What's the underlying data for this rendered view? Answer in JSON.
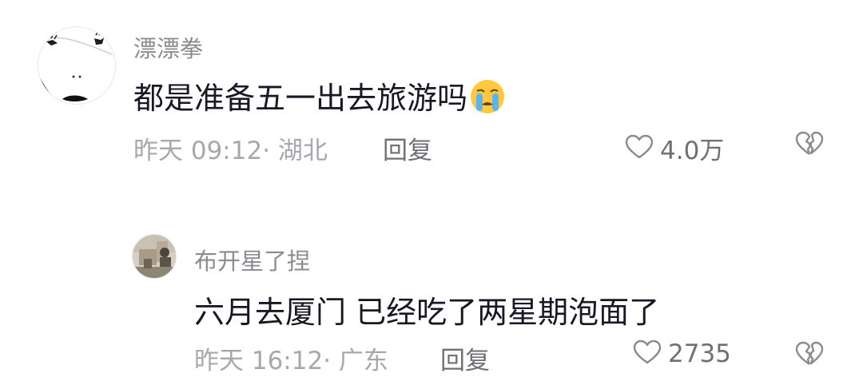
{
  "comments": [
    {
      "username": "漂漂拳",
      "text": "都是准备五一出去旅游吗",
      "emoji_icon": "crying-face-icon",
      "time": "昨天 09:12",
      "location": "· 湖北",
      "reply_label": "回复",
      "like_count": "4.0万",
      "like_icon": "heart-outline-icon",
      "dislike_icon": "broken-heart-icon"
    },
    {
      "username": "布开星了捏",
      "text": "六月去厦门 已经吃了两星期泡面了",
      "time": "昨天 16:12",
      "location": "· 广东",
      "reply_label": "回复",
      "like_count": "2735",
      "like_icon": "heart-outline-icon",
      "dislike_icon": "broken-heart-icon"
    }
  ],
  "colors": {
    "username": "#8a8b91",
    "text": "#161823",
    "meta": "#a7a8ad",
    "icon": "#8a8b91"
  }
}
